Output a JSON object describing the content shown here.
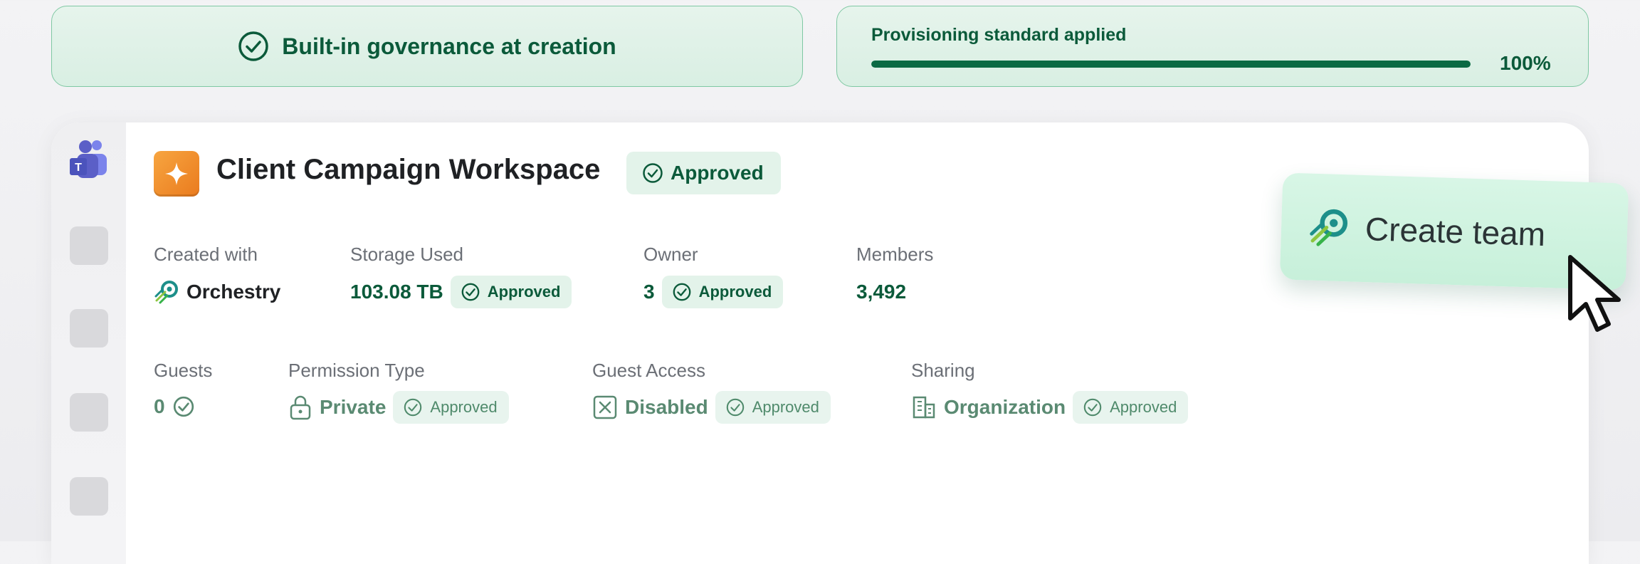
{
  "banner_left": {
    "text": "Built-in governance at creation"
  },
  "banner_right": {
    "label": "Provisioning standard applied",
    "progress": 1.0,
    "progress_text": "100%"
  },
  "workspace": {
    "title": "Client Campaign Workspace",
    "status": "Approved",
    "fields": {
      "created_with": {
        "label": "Created with",
        "value": "Orchestry"
      },
      "storage": {
        "label": "Storage Used",
        "value": "103.08 TB",
        "status": "Approved"
      },
      "owner": {
        "label": "Owner",
        "value": "3",
        "status": "Approved"
      },
      "members": {
        "label": "Members",
        "value": "3,492"
      },
      "guests": {
        "label": "Guests",
        "value": "0"
      },
      "permission": {
        "label": "Permission Type",
        "value": "Private",
        "status": "Approved"
      },
      "guest_access": {
        "label": "Guest Access",
        "value": "Disabled",
        "status": "Approved"
      },
      "sharing": {
        "label": "Sharing",
        "value": "Organization",
        "status": "Approved"
      }
    }
  },
  "create_team": {
    "label": "Create team"
  },
  "colors": {
    "accent": "#0b5a3a",
    "pill_bg": "#e3f3ea",
    "banner_border": "#7fc8a3",
    "tile": "#f08b2a"
  },
  "icons": [
    "check-circle-icon",
    "teams-icon",
    "sparkle-icon",
    "orchestry-logo-icon",
    "lock-icon",
    "x-box-icon",
    "building-icon",
    "cursor-icon"
  ]
}
